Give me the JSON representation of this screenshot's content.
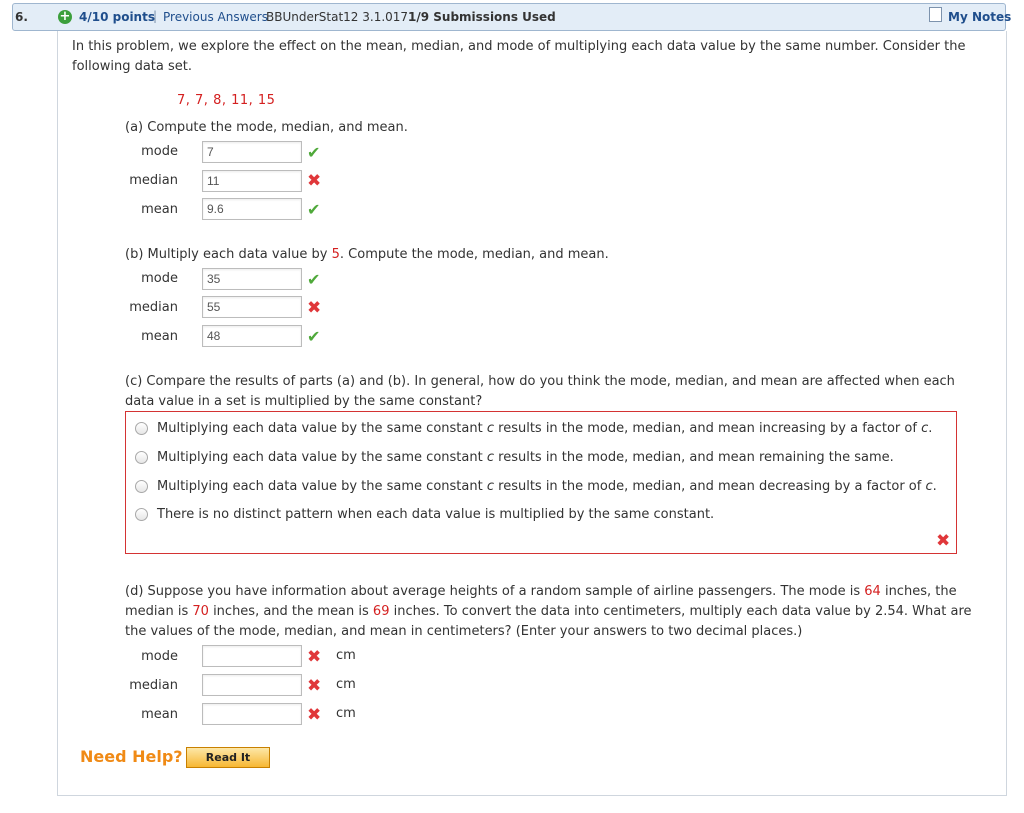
{
  "header": {
    "question_number": "6.",
    "points": "4/10 points",
    "separator": "|",
    "previous_answers": "Previous Answers",
    "code": "BBUnderStat12 3.1.017.",
    "submissions": "1/9 Submissions Used",
    "my_notes": "My Notes"
  },
  "intro": {
    "line1": "In this problem, we explore the effect on the mean, median, and mode of multiplying each data value by the same number. Consider the",
    "line2": "following data set.",
    "dataset": "7, 7, 8, 11, 15"
  },
  "part_a": {
    "prompt": "(a) Compute the mode, median, and mean.",
    "rows": [
      {
        "label": "mode",
        "value": "7",
        "status": "correct"
      },
      {
        "label": "median",
        "value": "11",
        "status": "incorrect"
      },
      {
        "label": "mean",
        "value": "9.6",
        "status": "correct"
      }
    ]
  },
  "part_b": {
    "prompt_pre": "(b) Multiply each data value by ",
    "multiplier": "5",
    "prompt_post": ". Compute the mode, median, and mean.",
    "rows": [
      {
        "label": "mode",
        "value": "35",
        "status": "correct"
      },
      {
        "label": "median",
        "value": "55",
        "status": "incorrect"
      },
      {
        "label": "mean",
        "value": "48",
        "status": "correct"
      }
    ]
  },
  "part_c": {
    "prompt_line1": "(c) Compare the results of parts (a) and (b). In general, how do you think the mode, median, and mean are affected when each",
    "prompt_line2": "data value in a set is multiplied by the same constant?",
    "options": [
      {
        "pre": "Multiplying each data value by the same constant ",
        "var": "c",
        "post": " results in the mode, median, and mean increasing by a factor of ",
        "var2": "c",
        "end": "."
      },
      {
        "pre": "Multiplying each data value by the same constant ",
        "var": "c",
        "post": " results in the mode, median, and mean remaining the same.",
        "var2": "",
        "end": ""
      },
      {
        "pre": "Multiplying each data value by the same constant ",
        "var": "c",
        "post": " results in the mode, median, and mean decreasing by a factor of ",
        "var2": "c",
        "end": "."
      },
      {
        "pre": "There is no distinct pattern when each data value is multiplied by the same constant.",
        "var": "",
        "post": "",
        "var2": "",
        "end": ""
      }
    ],
    "status": "incorrect"
  },
  "part_d": {
    "line1_pre": "(d) Suppose you have information about average heights of a random sample of airline passengers. The mode is ",
    "mode_val": "64",
    "line1_post": " inches, the",
    "line2_pre": "median is ",
    "median_val": "70",
    "line2_mid": " inches, and the mean is ",
    "mean_val": "69",
    "line2_post": " inches. To convert the data into centimeters, multiply each data value by 2.54. What are",
    "line3": "the values of the mode, median, and mean in centimeters? (Enter your answers to two decimal places.)",
    "rows": [
      {
        "label": "mode",
        "value": "",
        "status": "incorrect",
        "unit": "cm"
      },
      {
        "label": "median",
        "value": "",
        "status": "incorrect",
        "unit": "cm"
      },
      {
        "label": "mean",
        "value": "",
        "status": "incorrect",
        "unit": "cm"
      }
    ]
  },
  "help": {
    "need_help": "Need Help?",
    "read_it": "Read It"
  },
  "icons": {
    "check": "✔",
    "cross": "✖",
    "plus": "+"
  }
}
